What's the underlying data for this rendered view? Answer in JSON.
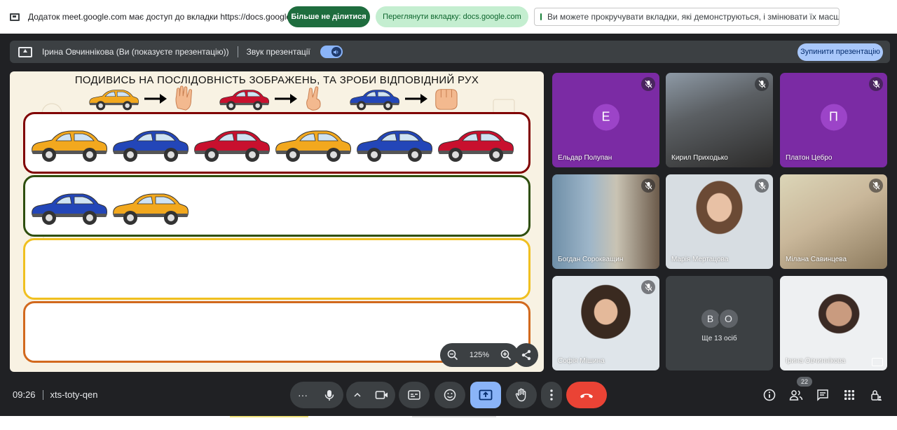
{
  "sharebar": {
    "text": "Додаток meet.google.com має доступ до вкладки https://docs.google.com",
    "stop_label": "Більше не ділитися",
    "view_label": "Переглянути вкладку: docs.google.com",
    "hint": "Ви можете прокручувати вкладки, які демонструються, і змінювати їх масштаб"
  },
  "presbar": {
    "presenter": "Ірина Овчиннікова (Ви (показуєте презентацію))",
    "audio_label": "Звук презентації",
    "audio_on": true,
    "stop_label": "Зупинити презентацію"
  },
  "slide": {
    "title": "ПОДИВИСЬ НА ПОСЛІДОВНІСТЬ ЗОБРАЖЕНЬ, ТА ЗРОБИ ВІДПОВІДНИЙ РУХ",
    "legend": [
      {
        "car": "orange",
        "gesture": "open-hand"
      },
      {
        "car": "red",
        "gesture": "two-fingers"
      },
      {
        "car": "blue",
        "gesture": "fist"
      }
    ],
    "rows": [
      {
        "border": "#800000",
        "cars": [
          "orange",
          "blue",
          "red",
          "orange",
          "blue",
          "red"
        ]
      },
      {
        "border": "#2f4f0f",
        "cars": [
          "blue",
          "orange"
        ]
      },
      {
        "border": "#f0c020",
        "cars": []
      },
      {
        "border": "#d2691e",
        "cars": []
      }
    ],
    "zoom": "125%"
  },
  "colors": {
    "orange": "#f2a81e",
    "blue": "#2346b8",
    "red": "#c8102e"
  },
  "participants": [
    {
      "name": "Ельдар Полупан",
      "initial": "Е",
      "type": "avatar",
      "bg": "#7b2ba4",
      "avatar_bg": "#9c44c8"
    },
    {
      "name": "Кирил Приходько",
      "type": "video",
      "scene": "dark"
    },
    {
      "name": "Платон Цебро",
      "initial": "П",
      "type": "avatar",
      "bg": "#7b2ba4",
      "avatar_bg": "#9c44c8"
    },
    {
      "name": "Богдан Сорокващин",
      "type": "video",
      "scene": "classroom"
    },
    {
      "name": "Марія Мертацова",
      "type": "video",
      "scene": "girl"
    },
    {
      "name": "Мілана Савинцева",
      "type": "video",
      "scene": "light"
    },
    {
      "name": "Софія Мішина",
      "type": "video",
      "scene": "girl2"
    },
    {
      "name": "",
      "type": "more",
      "initials": [
        "В",
        "О"
      ],
      "label": "Ще 13 осіб"
    },
    {
      "name": "Ірина Овчиннікова",
      "type": "video",
      "scene": "woman"
    }
  ],
  "bottombar": {
    "time": "09:26",
    "meeting_code": "xts-toty-qen",
    "people_count": "22"
  }
}
